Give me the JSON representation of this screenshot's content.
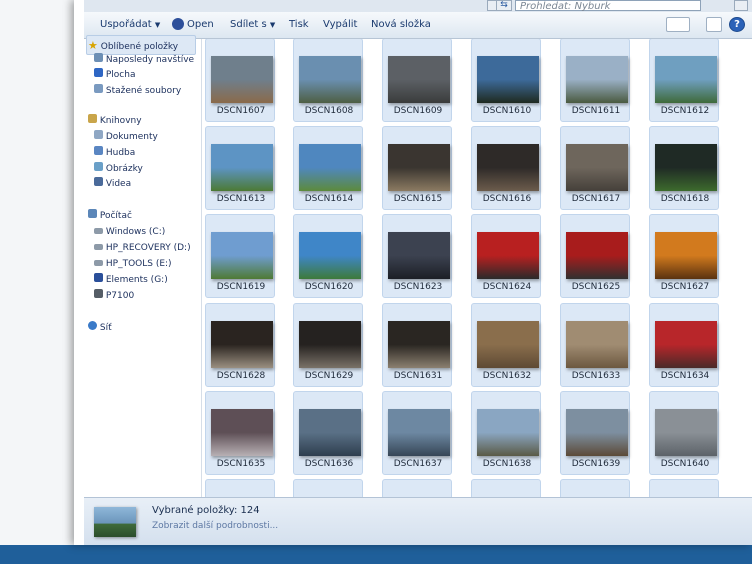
{
  "search": {
    "placeholder": "Prohledat: Nyburk"
  },
  "toolbar": {
    "organize": "Uspořádat",
    "open": "Open",
    "share": "Sdílet s",
    "print": "Tisk",
    "burn": "Vypálit",
    "new_folder": "Nová složka"
  },
  "nav": {
    "favorites": {
      "title": "Oblíbené položky",
      "items": [
        "Naposledy navštíve",
        "Plocha",
        "Stažené soubory"
      ]
    },
    "libraries": {
      "title": "Knihovny",
      "items": [
        "Dokumenty",
        "Hudba",
        "Obrázky",
        "Videa"
      ]
    },
    "computer": {
      "title": "Počítač",
      "items": [
        "Windows (C:)",
        "HP_RECOVERY (D:)",
        "HP_TOOLS (E:)",
        "Elements (G:)",
        "P7100"
      ]
    },
    "network": {
      "title": "Síť"
    }
  },
  "files": [
    {
      "name": "DSCN1607",
      "c1": "#6f7f8c",
      "c2": "#8a6a4a"
    },
    {
      "name": "DSCN1608",
      "c1": "#6a8fb0",
      "c2": "#4e5f44"
    },
    {
      "name": "DSCN1609",
      "c1": "#5c6065",
      "c2": "#3a3c3c"
    },
    {
      "name": "DSCN1610",
      "c1": "#3d6a9a",
      "c2": "#1f2a20"
    },
    {
      "name": "DSCN1611",
      "c1": "#9ab0c6",
      "c2": "#4a5a40"
    },
    {
      "name": "DSCN1612",
      "c1": "#6f9fc0",
      "c2": "#3f6a3a"
    },
    {
      "name": "DSCN1613",
      "c1": "#5d94c4",
      "c2": "#4c7a34"
    },
    {
      "name": "DSCN1614",
      "c1": "#4f87bf",
      "c2": "#5c8a3c"
    },
    {
      "name": "DSCN1615",
      "c1": "#3a3530",
      "c2": "#8c7b62"
    },
    {
      "name": "DSCN1616",
      "c1": "#2e2a28",
      "c2": "#6c5c4c"
    },
    {
      "name": "DSCN1617",
      "c1": "#6e665c",
      "c2": "#45403a"
    },
    {
      "name": "DSCN1618",
      "c1": "#1f2a25",
      "c2": "#3d6b2d"
    },
    {
      "name": "DSCN1619",
      "c1": "#6f9dd0",
      "c2": "#4f7a34"
    },
    {
      "name": "DSCN1620",
      "c1": "#3f86c8",
      "c2": "#3d7a3a"
    },
    {
      "name": "DSCN1623",
      "c1": "#3c4250",
      "c2": "#1c1f26"
    },
    {
      "name": "DSCN1624",
      "c1": "#b82020",
      "c2": "#2a2a2a"
    },
    {
      "name": "DSCN1625",
      "c1": "#a81c1c",
      "c2": "#303030"
    },
    {
      "name": "DSCN1627",
      "c1": "#d27a1e",
      "c2": "#5a3210"
    },
    {
      "name": "DSCN1628",
      "c1": "#2a2420",
      "c2": "#9a8f80"
    },
    {
      "name": "DSCN1629",
      "c1": "#252220",
      "c2": "#7a7268"
    },
    {
      "name": "DSCN1631",
      "c1": "#2a2622",
      "c2": "#8b8070"
    },
    {
      "name": "DSCN1632",
      "c1": "#8a6e4c",
      "c2": "#5e4a34"
    },
    {
      "name": "DSCN1633",
      "c1": "#a08c72",
      "c2": "#6c5840"
    },
    {
      "name": "DSCN1634",
      "c1": "#b8262a",
      "c2": "#4a2a28"
    },
    {
      "name": "DSCN1635",
      "c1": "#5e4f56",
      "c2": "#b8b0b4"
    },
    {
      "name": "DSCN1636",
      "c1": "#5a7086",
      "c2": "#2e3e4e"
    },
    {
      "name": "DSCN1637",
      "c1": "#6d88a2",
      "c2": "#364656"
    },
    {
      "name": "DSCN1638",
      "c1": "#8aa6c2",
      "c2": "#5a5a46"
    },
    {
      "name": "DSCN1639",
      "c1": "#7d8fa0",
      "c2": "#5c4a38"
    },
    {
      "name": "DSCN1640",
      "c1": "#8a9096",
      "c2": "#5c6268"
    }
  ],
  "status": {
    "selected": "Vybrané položky: 124",
    "details": "Zobrazit další podrobnosti..."
  },
  "colors": {
    "accent": "#1a3a6e",
    "selection": "#dce8f6"
  }
}
